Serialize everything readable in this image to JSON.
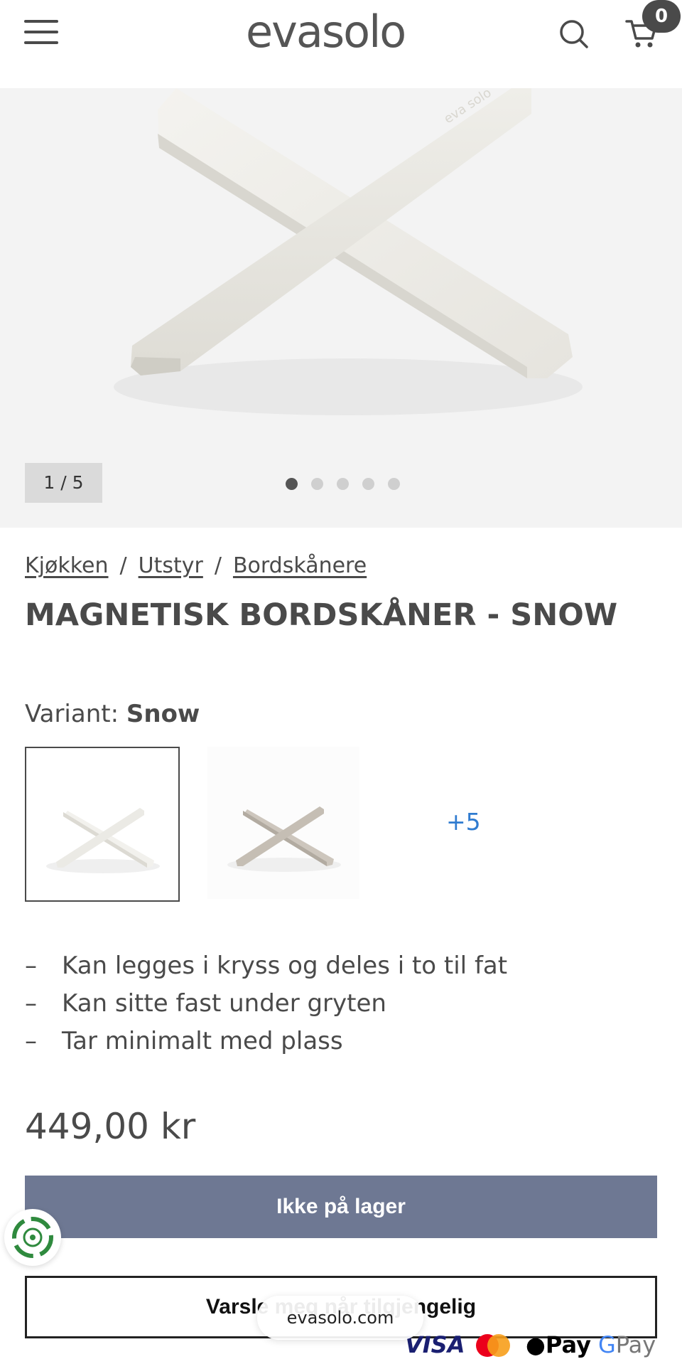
{
  "header": {
    "logo_light": "eva",
    "logo_bold": "solo",
    "cart_count": "0"
  },
  "gallery": {
    "counter": "1 / 5",
    "dot_count": 5,
    "active_dot": 0
  },
  "breadcrumb": {
    "items": [
      "Kjøkken",
      "Utstyr",
      "Bordskånere"
    ],
    "separator": "/"
  },
  "product": {
    "title": "MAGNETISK BORDSKÅNER - SNOW",
    "variant_label": "Variant:",
    "variant_value": "Snow",
    "more_variants": "+5",
    "features": [
      "Kan legges i kryss og deles i to til fat",
      "Kan sitte fast under gryten",
      "Tar minimalt med plass"
    ],
    "feature_bullet": "–",
    "price": "449,00 kr"
  },
  "actions": {
    "stock_label": "Ikke på lager",
    "notify_label": "Varsle meg når tilgjengelig"
  },
  "browser": {
    "url": "evasolo.com"
  },
  "payments": {
    "visa": "VISA",
    "apple_pay": "Pay",
    "google_pay": "Pay"
  },
  "colors": {
    "text": "#4a4a4a",
    "stock_button": "#6e7893",
    "link_blue": "#2f7bd0",
    "hero_bg": "#f3f3f3"
  }
}
